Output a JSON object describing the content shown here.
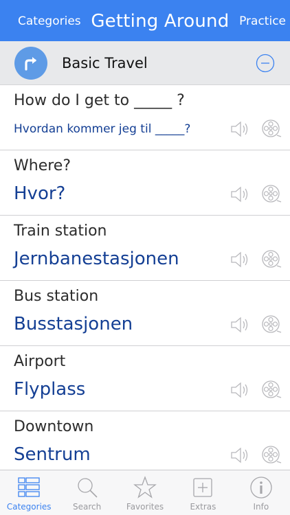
{
  "navbar": {
    "left_button": "Categories",
    "title": "Getting Around",
    "right_button": "Practice"
  },
  "section": {
    "title": "Basic Travel"
  },
  "phrases": [
    {
      "english": "How do I get to _____ ?",
      "norwegian": "Hvordan kommer jeg til _____?"
    },
    {
      "english": "Where?",
      "norwegian": "Hvor?"
    },
    {
      "english": "Train station",
      "norwegian": "Jernbanestasjonen"
    },
    {
      "english": "Bus station",
      "norwegian": "Busstasjonen"
    },
    {
      "english": "Airport",
      "norwegian": "Flyplass"
    },
    {
      "english": "Downtown",
      "norwegian": "Sentrum"
    }
  ],
  "tabs": [
    {
      "label": "Categories",
      "icon": "list-icon",
      "active": true
    },
    {
      "label": "Search",
      "icon": "search-icon",
      "active": false
    },
    {
      "label": "Favorites",
      "icon": "star-icon",
      "active": false
    },
    {
      "label": "Extras",
      "icon": "plus-box-icon",
      "active": false
    },
    {
      "label": "Info",
      "icon": "info-icon",
      "active": false
    }
  ],
  "colors": {
    "accent": "#3b82f0",
    "norwegian_text": "#143f94",
    "section_bg": "#e8e9eb"
  }
}
